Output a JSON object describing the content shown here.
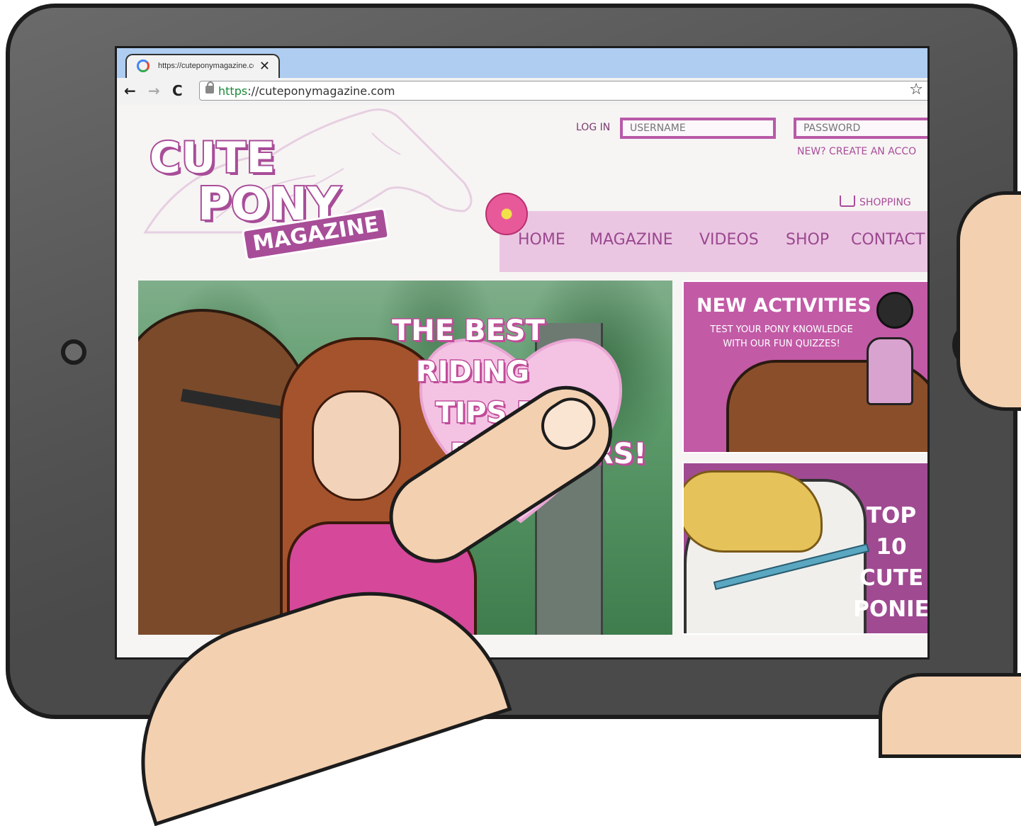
{
  "browser": {
    "tab_title": "https://cuteponymagazine.com",
    "tab_close": "✕",
    "back": "←",
    "forward": "→",
    "reload": "C",
    "url_scheme": "https",
    "url_rest": "://cuteponymagazine.com",
    "bookmark_star": "☆"
  },
  "site": {
    "logo_line1": "CUTE",
    "logo_line2": "PONY",
    "logo_line3": "MAGAZINE",
    "login_label": "LOG IN",
    "username_placeholder": "USERNAME",
    "password_placeholder": "PASSWORD",
    "create_account": "NEW? CREATE AN ACCO",
    "shopping": "SHOPPING",
    "nav": [
      "HOME",
      "MAGAZINE",
      "VIDEOS",
      "SHOP",
      "CONTACT"
    ]
  },
  "hero": {
    "line1": "THE BEST",
    "line2": "RIDING",
    "line3": "TIPS FOR",
    "line4": "BEGINNERS!"
  },
  "cards": {
    "activities_title": "NEW ACTIVITIES",
    "activities_sub": "TEST YOUR PONY KNOWLEDGE WITH OUR FUN QUIZZES!",
    "top_line1": "TOP",
    "top_line2": "10",
    "top_line3": "CUTE",
    "top_line4": "PONIE"
  },
  "colors": {
    "brand_pink": "#a84d98",
    "nav_band": "#ebc6e2",
    "card_pink": "#c25aa6"
  }
}
